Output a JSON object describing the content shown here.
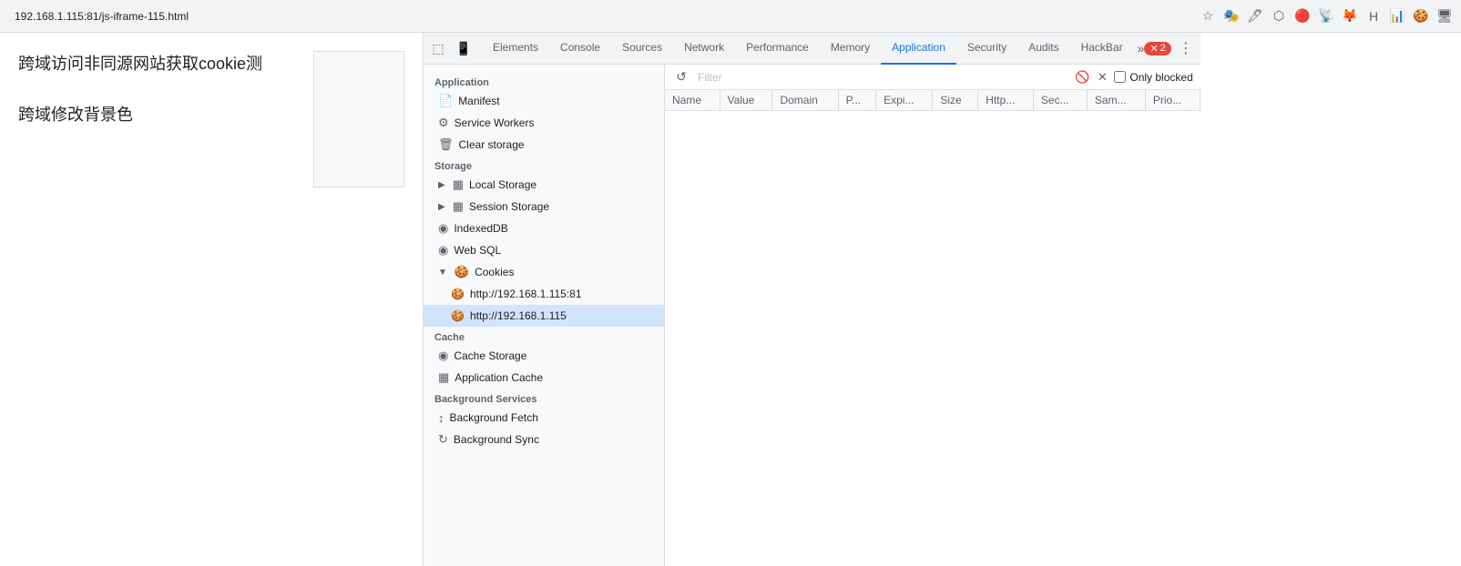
{
  "topbar": {
    "url": "192.168.1.115:81/js-iframe-115.html"
  },
  "page": {
    "text1": "跨域访问非同源网站获取cookie测",
    "text2": "跨域修改背景色"
  },
  "devtools": {
    "tabs": [
      {
        "id": "elements",
        "label": "Elements",
        "active": false
      },
      {
        "id": "console",
        "label": "Console",
        "active": false
      },
      {
        "id": "sources",
        "label": "Sources",
        "active": false
      },
      {
        "id": "network",
        "label": "Network",
        "active": false
      },
      {
        "id": "performance",
        "label": "Performance",
        "active": false
      },
      {
        "id": "memory",
        "label": "Memory",
        "active": false
      },
      {
        "id": "application",
        "label": "Application",
        "active": true
      },
      {
        "id": "security",
        "label": "Security",
        "active": false
      },
      {
        "id": "audits",
        "label": "Audits",
        "active": false
      },
      {
        "id": "hackbar",
        "label": "HackBar",
        "active": false
      }
    ],
    "badge_count": "2",
    "more_tabs_icon": "»"
  },
  "sidebar": {
    "sections": [
      {
        "label": "Application",
        "items": [
          {
            "id": "manifest",
            "label": "Manifest",
            "icon": "📄",
            "indent": 1
          },
          {
            "id": "service-workers",
            "label": "Service Workers",
            "icon": "⚙",
            "indent": 1
          },
          {
            "id": "clear-storage",
            "label": "Clear storage",
            "icon": "🗑",
            "indent": 1
          }
        ]
      },
      {
        "label": "Storage",
        "items": [
          {
            "id": "local-storage",
            "label": "Local Storage",
            "icon": "▦",
            "indent": 1,
            "expandable": true,
            "expanded": false
          },
          {
            "id": "session-storage",
            "label": "Session Storage",
            "icon": "▦",
            "indent": 1,
            "expandable": true,
            "expanded": false
          },
          {
            "id": "indexeddb",
            "label": "IndexedDB",
            "icon": "◉",
            "indent": 1
          },
          {
            "id": "web-sql",
            "label": "Web SQL",
            "icon": "◉",
            "indent": 1
          },
          {
            "id": "cookies",
            "label": "Cookies",
            "icon": "🍪",
            "indent": 1,
            "expandable": true,
            "expanded": true
          },
          {
            "id": "cookies-115-81",
            "label": "http://192.168.1.115:81",
            "icon": "🍪",
            "indent": 2,
            "sub": true
          },
          {
            "id": "cookies-115",
            "label": "http://192.168.1.115",
            "icon": "🍪",
            "indent": 2,
            "sub": true,
            "active": true
          }
        ]
      },
      {
        "label": "Cache",
        "items": [
          {
            "id": "cache-storage",
            "label": "Cache Storage",
            "icon": "◉",
            "indent": 1
          },
          {
            "id": "application-cache",
            "label": "Application Cache",
            "icon": "▦",
            "indent": 1
          }
        ]
      },
      {
        "label": "Background Services",
        "items": [
          {
            "id": "background-fetch",
            "label": "Background Fetch",
            "icon": "↕",
            "indent": 1
          },
          {
            "id": "background-sync",
            "label": "Background Sync",
            "icon": "↻",
            "indent": 1
          }
        ]
      }
    ]
  },
  "cookie_panel": {
    "filter_placeholder": "Filter",
    "only_blocked_label": "Only blocked",
    "columns": [
      "Name",
      "Value",
      "Domain",
      "P...",
      "Expi...",
      "Size",
      "Http...",
      "Sec...",
      "Sam...",
      "Prio..."
    ]
  }
}
